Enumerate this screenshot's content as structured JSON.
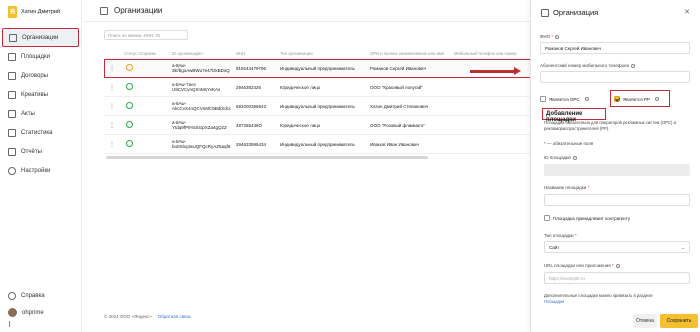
{
  "user": {
    "name": "Хатин Дмитрий",
    "logo": "Я"
  },
  "sidebar": {
    "items": [
      {
        "label": "Организации",
        "icon": "organization-icon"
      },
      {
        "label": "Площадки",
        "icon": "platform-icon"
      },
      {
        "label": "Договоры",
        "icon": "contract-icon"
      },
      {
        "label": "Креативы",
        "icon": "creative-icon"
      },
      {
        "label": "Акты",
        "icon": "acts-icon"
      },
      {
        "label": "Статистика",
        "icon": "statistics-icon"
      },
      {
        "label": "Отчёты",
        "icon": "reports-icon"
      },
      {
        "label": "Настройки",
        "icon": "settings-icon"
      }
    ],
    "help_label": "Справка",
    "account_label": "ohprime"
  },
  "header": {
    "title": "Организации"
  },
  "search": {
    "placeholder": "Поиск по имени, ИНН, ID"
  },
  "table": {
    "columns": [
      "Статус отправки",
      "ID организации ↓",
      "ИНН",
      "Тип организации",
      "ОРИ и полное наименование или имя",
      "Мобильный телефон или номер"
    ],
    "rows": [
      {
        "status": "pending",
        "id": "a-8Aw-3E/bgoAwBWu7e47lzkBDxQ",
        "inn": "819244479796",
        "type": "Индивидуальный предприниматель",
        "name": "Романов Сергей Иванович"
      },
      {
        "status": "ok",
        "id": "a-8Aw-7ace U9CVCvnQXnMsYvKAs",
        "inn": "2946382426",
        "type": "Юридическое лицо",
        "name": "ООО \"Красивый попугай\""
      },
      {
        "status": "ok",
        "id": "a-8Aw-AkcCvX4nQCVnMC9BdiXdcc",
        "inn": "691000396943",
        "type": "Индивидуальный предприниматель",
        "name": "Хатин Дмитрий Степанович"
      },
      {
        "status": "ok",
        "id": "a-8Aw-Ytdq9fP9YaSGpXZa4gQ2Z",
        "inn": "487265439O",
        "type": "Юридическое лицо",
        "name": "ООО \"Розовый фламинго\""
      },
      {
        "status": "ok",
        "id": "a-8Aw-bu0Xbq4aUQFQcRyAZ5aqf8",
        "inn": "294633995434",
        "type": "Индивидуальный предприниматель",
        "name": "Иванов Иван Иванович"
      }
    ]
  },
  "footer": {
    "copyright": "© 2024 ООО «Яндекс»",
    "feedback": "Обратная связь"
  },
  "panel": {
    "title": "Организация",
    "fio_label": "ФИО",
    "fio_value": "Романов Сергей Иванович",
    "phone_label": "Абонентский номер мобильного телефона",
    "is_ors_label": "Является ОРС",
    "is_rr_label": "Является РР",
    "add_platform_title": "Добавление площадки",
    "add_platform_note": "Площадка обязательна для операторов рекламных систем (ОРС) и рекламораспространителей (РР).",
    "required_note": "* — обязательные поля",
    "platform_id_label": "ID площадки",
    "platform_name_label": "Название площадки",
    "belongs_label": "Площадка принадлежит контрагенту",
    "platform_type_label": "Тип площадки",
    "platform_type_value": "Сайт",
    "url_label": "URL площадки или приложения",
    "url_placeholder": "https://example.ru",
    "extra_note": "Дополнительные площадки можно привязать в разделе",
    "extra_link": "Площадки",
    "cancel": "Отмена",
    "save": "Сохранить"
  }
}
